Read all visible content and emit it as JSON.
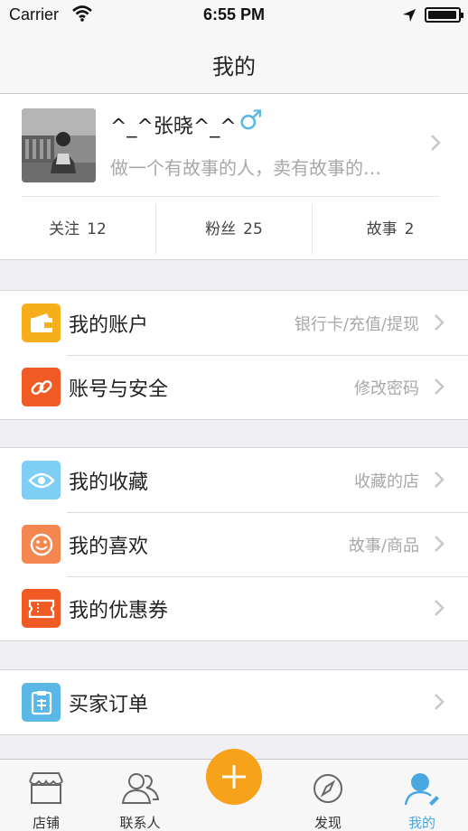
{
  "status_bar": {
    "carrier": "Carrier",
    "time": "6:55 PM"
  },
  "nav": {
    "title": "我的"
  },
  "profile": {
    "username": "^_^张晓^_^",
    "gender_icon": "male-icon",
    "bio": "做一个有故事的人，卖有故事的…",
    "stats": [
      {
        "label": "关注",
        "count": "12"
      },
      {
        "label": "粉丝",
        "count": "25"
      },
      {
        "label": "故事",
        "count": "2"
      }
    ]
  },
  "groups": {
    "account": [
      {
        "label": "我的账户",
        "detail": "银行卡/充值/提现",
        "icon": "wallet-icon",
        "color": "#f6ae1b"
      },
      {
        "label": "账号与安全",
        "detail": "修改密码",
        "icon": "link-icon",
        "color": "#f05a24"
      }
    ],
    "favorites": [
      {
        "label": "我的收藏",
        "detail": "收藏的店",
        "icon": "eye-icon",
        "color": "#7ecff3"
      },
      {
        "label": "我的喜欢",
        "detail": "故事/商品",
        "icon": "smile-icon",
        "color": "#f4874f"
      },
      {
        "label": "我的优惠券",
        "detail": "",
        "icon": "ticket-icon",
        "color": "#f05a24"
      }
    ],
    "orders": [
      {
        "label": "买家订单",
        "detail": "",
        "icon": "order-icon",
        "color": "#5bb8e6"
      }
    ]
  },
  "tab_bar": {
    "items": [
      {
        "label": "店铺",
        "icon": "shop-icon"
      },
      {
        "label": "联系人",
        "icon": "contacts-icon"
      },
      {
        "label": "发现",
        "icon": "compass-icon"
      },
      {
        "label": "我的",
        "icon": "profile-icon",
        "active": true
      }
    ],
    "add_icon": "plus-icon",
    "active_color": "#4aa8e0",
    "add_color": "#f7a21b"
  }
}
